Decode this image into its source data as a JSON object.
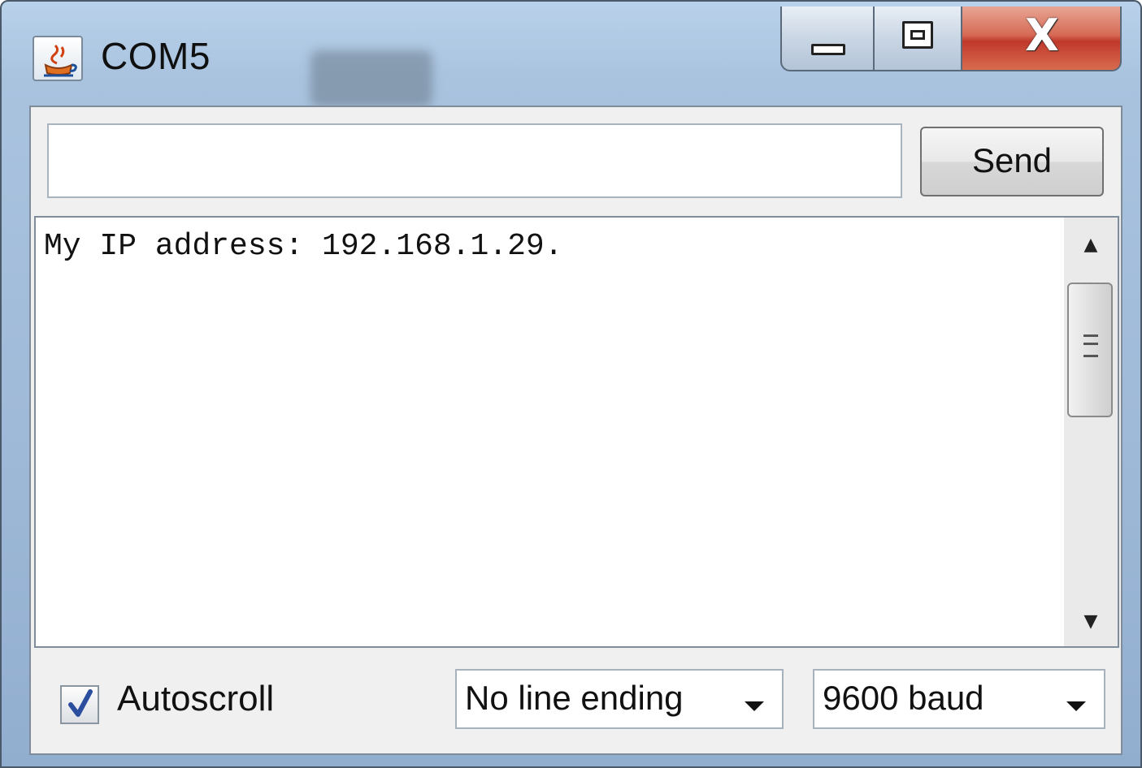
{
  "window": {
    "title": "COM5",
    "icon": "java-cup-icon",
    "controls": [
      "minimize-icon",
      "maximize-icon",
      "close-icon"
    ],
    "close_glyph": "X"
  },
  "send_bar": {
    "input_value": "",
    "send_label": "Send"
  },
  "output": {
    "lines": [
      "My IP address: 192.168.1.29."
    ],
    "scrollbar": {
      "up_glyph": "▲",
      "down_glyph": "▼"
    }
  },
  "footer": {
    "autoscroll_label": "Autoscroll",
    "autoscroll_checked": true,
    "line_ending_selected": "No line ending",
    "baud_selected": "9600 baud"
  },
  "colors": {
    "title_bar": "#a9c3df",
    "close_button": "#c0392b",
    "panel_background": "#f0f0f0"
  }
}
